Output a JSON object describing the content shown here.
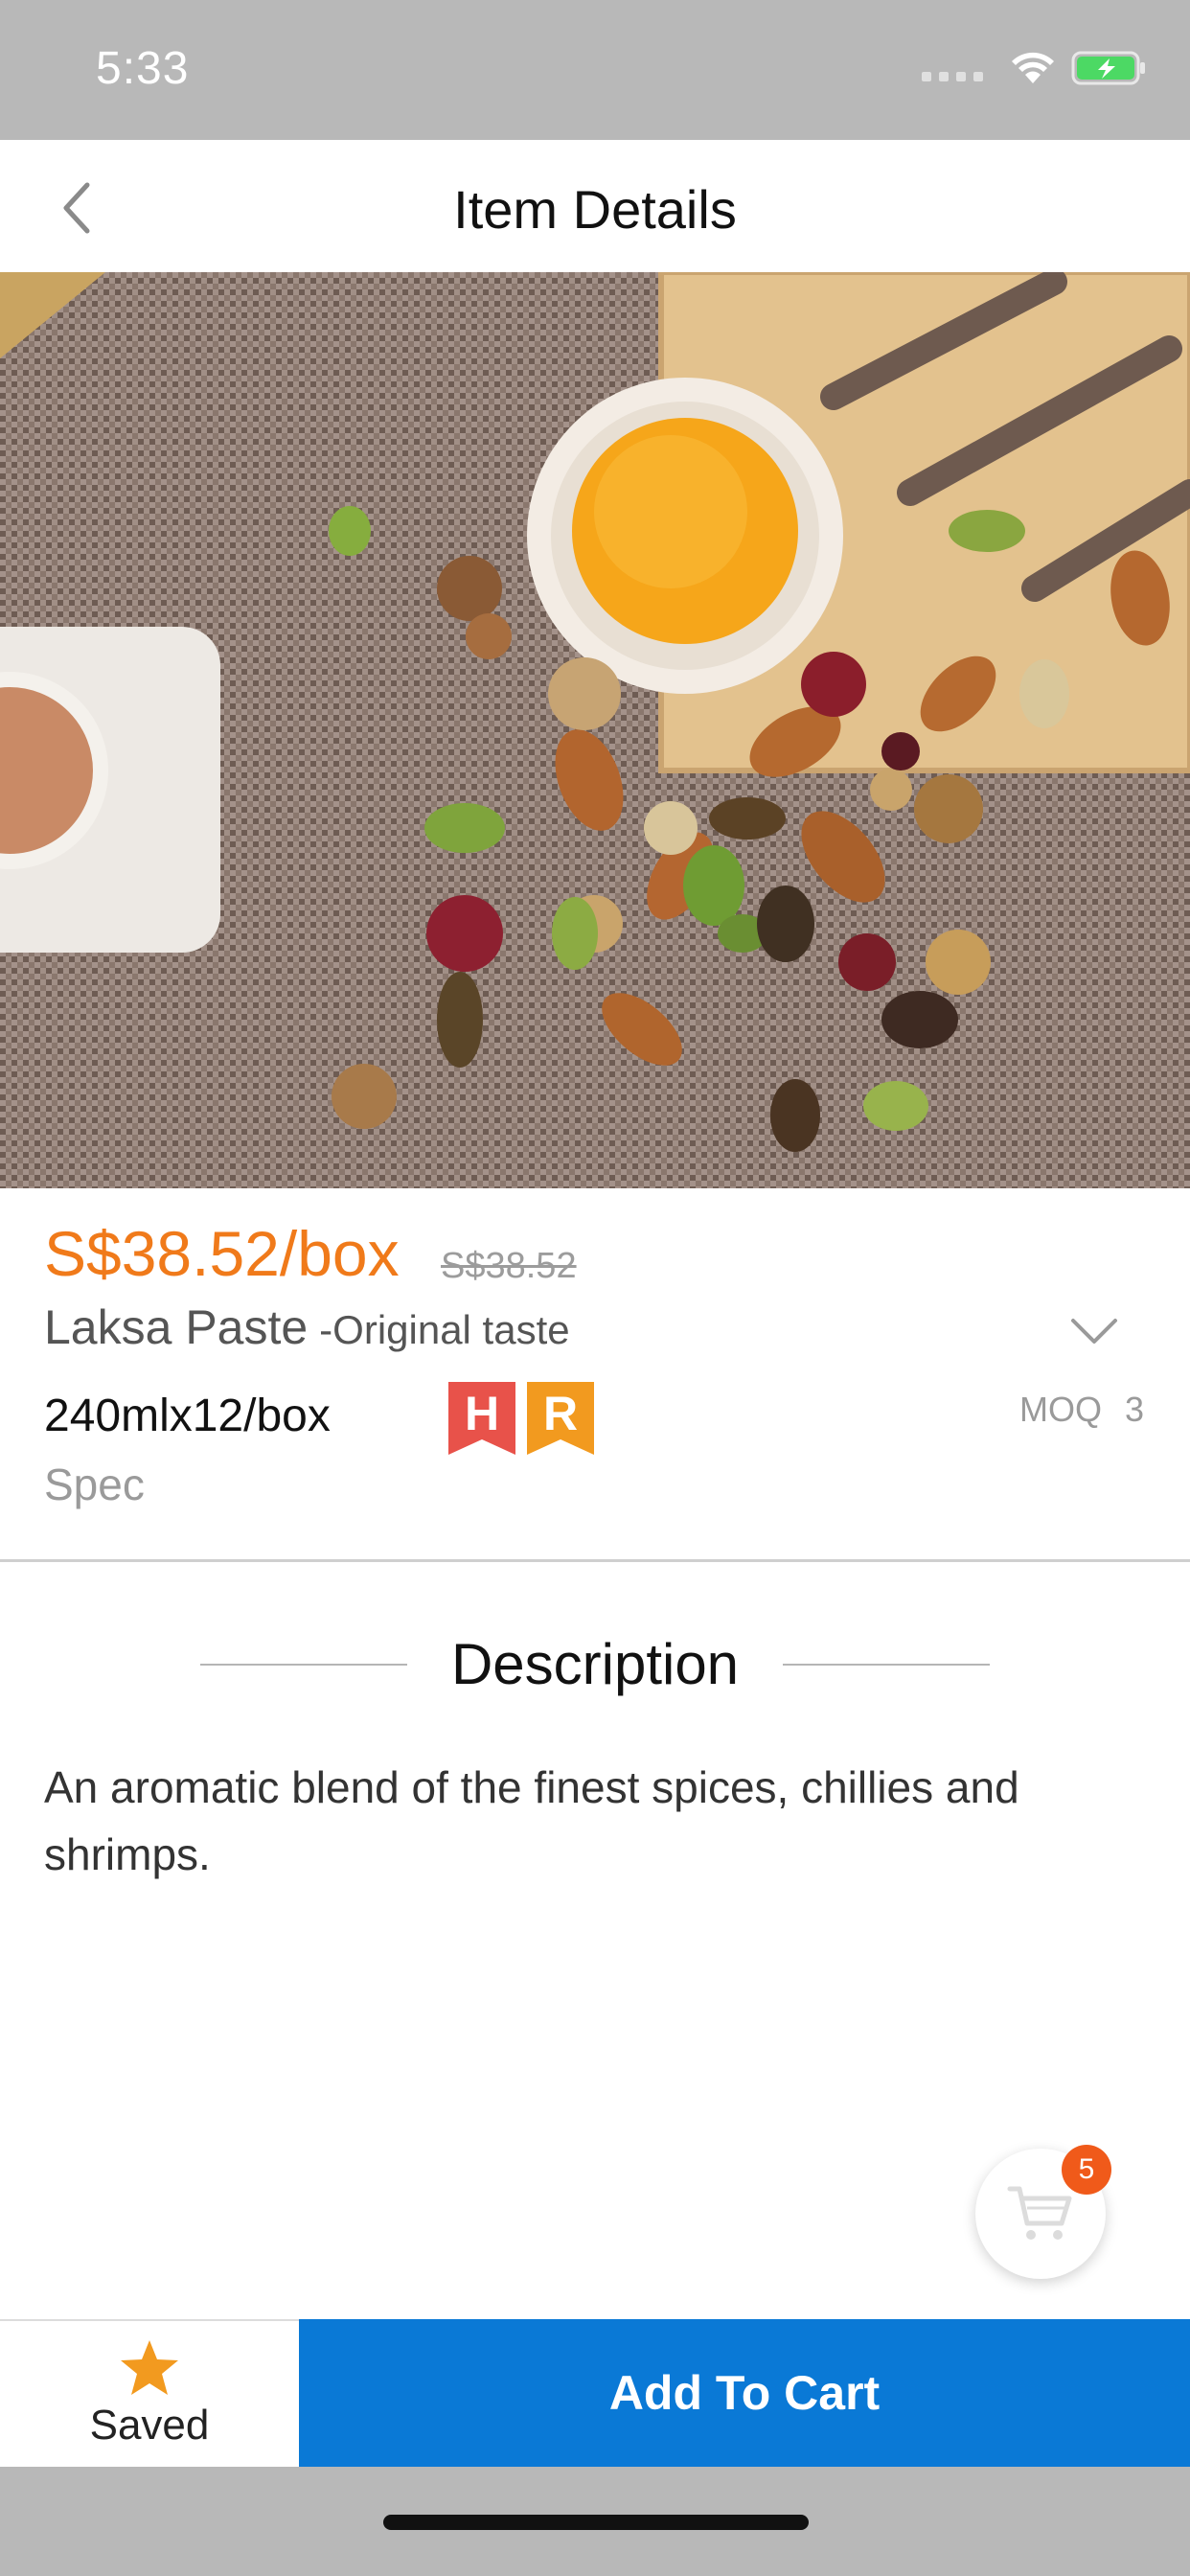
{
  "status_bar": {
    "time": "5:33",
    "icons": [
      "signal-dots-icon",
      "wifi-icon",
      "battery-charging-icon"
    ],
    "battery_color": "#4cd964"
  },
  "nav": {
    "title": "Item Details",
    "back_icon": "chevron-left-icon"
  },
  "product": {
    "price": "S$38.52/box",
    "original_price": "S$38.52",
    "name": "Laksa Paste",
    "variant": "-Original taste",
    "spec_value": "240mlx12/box",
    "spec_label": "Spec",
    "badges": [
      {
        "letter": "H",
        "color": "#e8524a"
      },
      {
        "letter": "R",
        "color": "#f29a1f"
      }
    ],
    "moq_label": "MOQ",
    "moq_value": "3"
  },
  "description": {
    "title": "Description",
    "text": "An aromatic blend of the finest spices, chillies and shrimps."
  },
  "cart": {
    "badge_count": "5"
  },
  "bottom_bar": {
    "saved_label": "Saved",
    "add_to_cart_label": "Add To Cart"
  },
  "colors": {
    "price": "#f07a1a",
    "primary_button": "#0a79d6",
    "saved_star": "#f29a1f",
    "cart_badge": "#f05a1a"
  }
}
